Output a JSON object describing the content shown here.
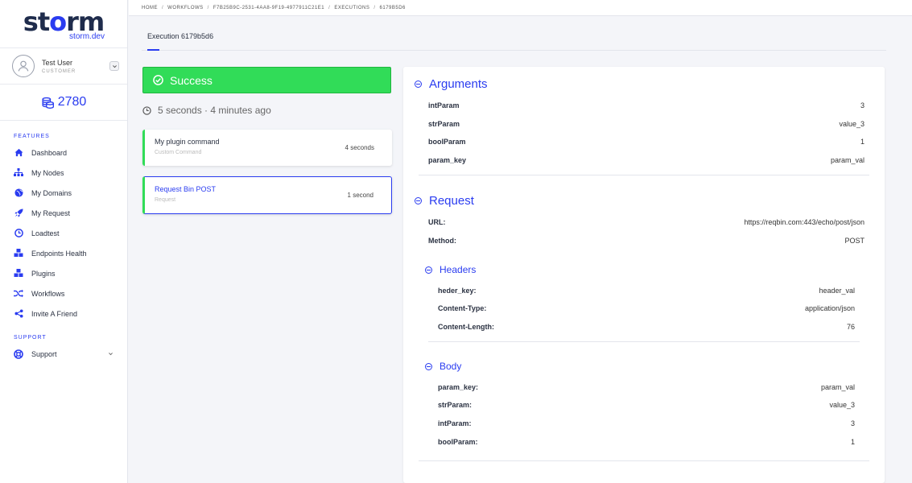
{
  "brand": {
    "name_pre": "st",
    "name_post": "rm",
    "bolt_char": "o",
    "subtitle": "storm.dev"
  },
  "user": {
    "name": "Test User",
    "role": "CUSTOMER"
  },
  "credits": "2780",
  "sidebar": {
    "features_label": "FEATURES",
    "support_label": "SUPPORT",
    "items": [
      {
        "label": "Dashboard",
        "icon": "home-icon"
      },
      {
        "label": "My Nodes",
        "icon": "sitemap-icon"
      },
      {
        "label": "My Domains",
        "icon": "globe-icon"
      },
      {
        "label": "My Request",
        "icon": "rocket-icon"
      },
      {
        "label": "Loadtest",
        "icon": "clock-icon"
      },
      {
        "label": "Endpoints Health",
        "icon": "cubes-icon"
      },
      {
        "label": "Plugins",
        "icon": "cubes-icon"
      },
      {
        "label": "Workflows",
        "icon": "shuffle-icon"
      },
      {
        "label": "Invite A Friend",
        "icon": "share-icon"
      }
    ],
    "support": {
      "label": "Support",
      "icon": "lifebuoy-icon"
    }
  },
  "breadcrumb": [
    "HOME",
    "WORKFLOWS",
    "F7B25B9C-2531-4AA8-9F19-4977911C21E1",
    "EXECUTIONS",
    "6179B5D6"
  ],
  "tab": {
    "label": "Execution 6179b5d6"
  },
  "status": {
    "label": "Success",
    "color": "#31dc58"
  },
  "duration": {
    "text": "5 seconds",
    "ago": "· 4 minutes ago"
  },
  "steps": [
    {
      "title": "My plugin command",
      "subtitle": "Custom Command",
      "time": "4 seconds"
    },
    {
      "title": "Request Bin POST",
      "subtitle": "Request",
      "time": "1 second"
    }
  ],
  "arguments": {
    "title": "Arguments",
    "rows": [
      {
        "k": "intParam",
        "v": "3"
      },
      {
        "k": "strParam",
        "v": "value_3"
      },
      {
        "k": "boolParam",
        "v": "1"
      },
      {
        "k": "param_key",
        "v": "param_val"
      }
    ]
  },
  "request": {
    "title": "Request",
    "url_label": "URL:",
    "url": "https://reqbin.com:443/echo/post/json",
    "method_label": "Method:",
    "method": "POST",
    "headers": {
      "title": "Headers",
      "rows": [
        {
          "k": "heder_key:",
          "v": "header_val"
        },
        {
          "k": "Content-Type:",
          "v": "application/json"
        },
        {
          "k": "Content-Length:",
          "v": "76"
        }
      ]
    },
    "body": {
      "title": "Body",
      "rows": [
        {
          "k": "param_key:",
          "v": "param_val"
        },
        {
          "k": "strParam:",
          "v": "value_3"
        },
        {
          "k": "intParam:",
          "v": "3"
        },
        {
          "k": "boolParam:",
          "v": "1"
        }
      ]
    }
  },
  "colors": {
    "accent": "#2a3cf0",
    "success": "#31dc58",
    "navy": "#1f2c4c"
  }
}
